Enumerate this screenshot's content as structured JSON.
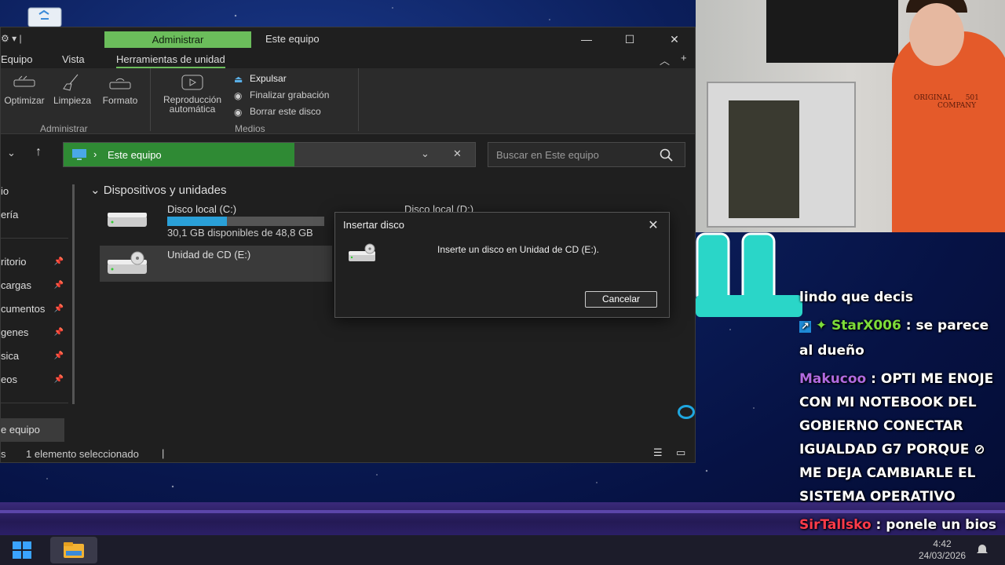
{
  "explorer": {
    "titlebar": {
      "contextual_tab": "Administrar",
      "title": "Este equipo"
    },
    "tabs": [
      "Equipo",
      "Vista",
      "Herramientas de unidad"
    ],
    "ribbon": {
      "buttons": [
        "Optimizar",
        "Limpieza",
        "Formato"
      ],
      "autoplay": [
        "Reproducción",
        "automática"
      ],
      "media_actions": [
        "Expulsar",
        "Finalizar grabación",
        "Borrar este disco"
      ],
      "group_labels": [
        "Administrar",
        "Medios"
      ]
    },
    "address": {
      "location": "Este equipo"
    },
    "search": {
      "placeholder": "Buscar en Este equipo"
    },
    "sidebar": [
      {
        "label": "io",
        "pinned": false
      },
      {
        "label": "ería",
        "pinned": false
      },
      {
        "label": "ritorio",
        "pinned": true
      },
      {
        "label": "cargas",
        "pinned": true
      },
      {
        "label": "cumentos",
        "pinned": true
      },
      {
        "label": "genes",
        "pinned": true
      },
      {
        "label": "sica",
        "pinned": true
      },
      {
        "label": "eos",
        "pinned": true
      },
      {
        "label": "e equipo",
        "pinned": false
      }
    ],
    "section": "Dispositivos y unidades",
    "drives": [
      {
        "name": "Disco local (C:)",
        "free": "30,1 GB disponibles de 48,8 GB",
        "used_fraction": 0.38
      },
      {
        "name": "Disco local (D:)"
      },
      {
        "name": "Unidad de CD (E:)"
      }
    ],
    "status": {
      "left": "s",
      "selection": "1 elemento seleccionado"
    }
  },
  "dialog": {
    "title": "Insertar disco",
    "message": "Inserte un disco en Unidad de CD (E:).",
    "cancel": "Cancelar"
  },
  "webcam": {
    "shirt_text": [
      "ORIGINAL",
      "501",
      "COMPANY"
    ]
  },
  "chat": [
    {
      "user": "",
      "text": "lindo que decis",
      "color": "#ffffff"
    },
    {
      "user": "StarX006",
      "text": " : se parece al dueño",
      "color": "#7ddc3a"
    },
    {
      "user": "Makucoo",
      "text": " : OPTI ME ENOJE CON MI NOTEBOOK DEL GOBIERNO CONECTAR IGUALDAD G7 PORQUE ⊘ ME DEJA CAMBIARLE EL SISTEMA OPERATIVO",
      "color": "#b06ae0"
    },
    {
      "user": "SirTallsko",
      "text": " : ponele un bios mod y andaría",
      "color": "#ff3b4a"
    }
  ],
  "taskbar": {
    "time": "4:42",
    "date": "24/03/2026"
  },
  "colors": {
    "accent_green": "#6bbd5b",
    "address_green": "#2f8a34",
    "drive_bar": "#2aa0d8"
  }
}
